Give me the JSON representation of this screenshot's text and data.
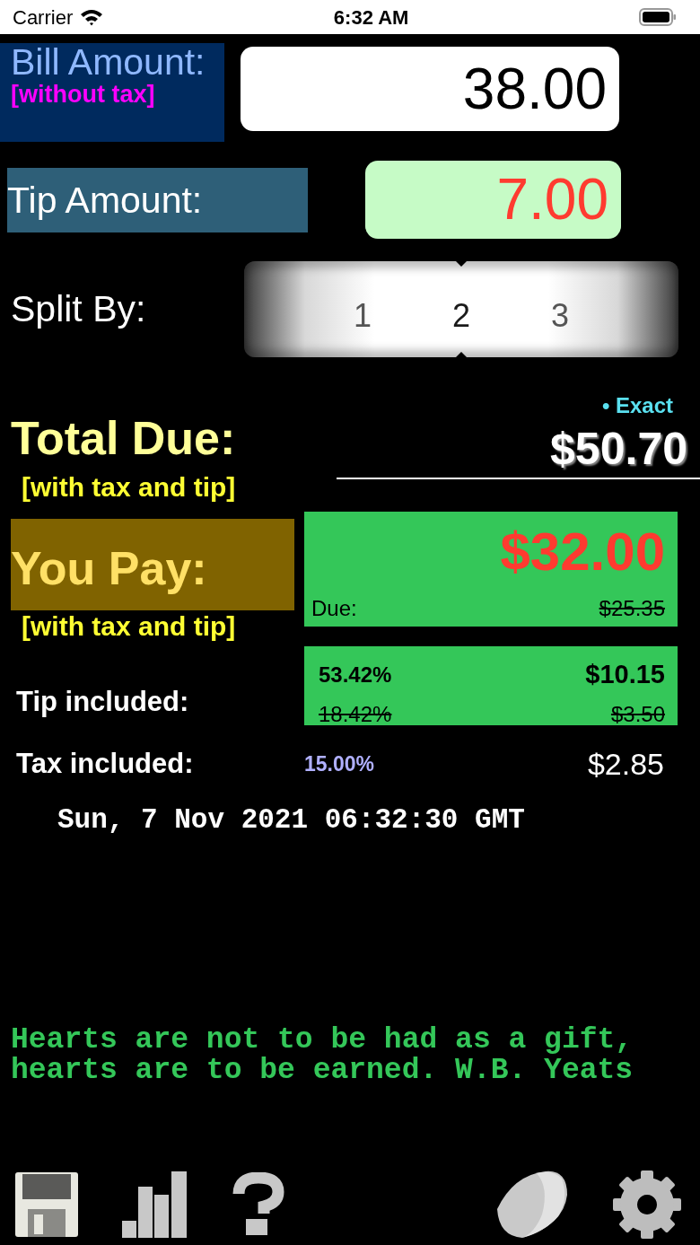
{
  "status_bar": {
    "carrier": "Carrier",
    "time": "6:32 AM"
  },
  "bill": {
    "label": "Bill Amount:",
    "note": "[without tax]",
    "value": "38.00"
  },
  "tip": {
    "label": "Tip Amount:",
    "value": "7.00"
  },
  "split": {
    "label": "Split By:",
    "options": [
      {
        "label": "1",
        "selected": false
      },
      {
        "label": "2",
        "selected": true
      },
      {
        "label": "3",
        "selected": false
      }
    ]
  },
  "total": {
    "label": "Total Due:",
    "note": "[with tax and tip]",
    "mode": "• Exact",
    "amount": "$50.70"
  },
  "you_pay": {
    "label": "You Pay:",
    "note": "[with tax and tip]",
    "amount": "$32.00",
    "due_label": "Due:",
    "due_amount": "$25.35"
  },
  "tip_included": {
    "label": "Tip included:",
    "percent": "53.42%",
    "amount": "$10.15",
    "original_percent": "18.42%",
    "original_amount": "$3.50"
  },
  "tax_included": {
    "label": "Tax included:",
    "percent": "15.00%",
    "amount": "$2.85"
  },
  "timestamp": "Sun, 7 Nov 2021 06:32:30 GMT",
  "quote": [
    "Hearts are not to be had as a gift,",
    "hearts are to be earned. W.B. Yeats"
  ],
  "toolbar": [
    {
      "kind": "save"
    },
    {
      "kind": "stats"
    },
    {
      "kind": "help"
    },
    {
      "kind": "fortune"
    },
    {
      "kind": "settings"
    }
  ]
}
